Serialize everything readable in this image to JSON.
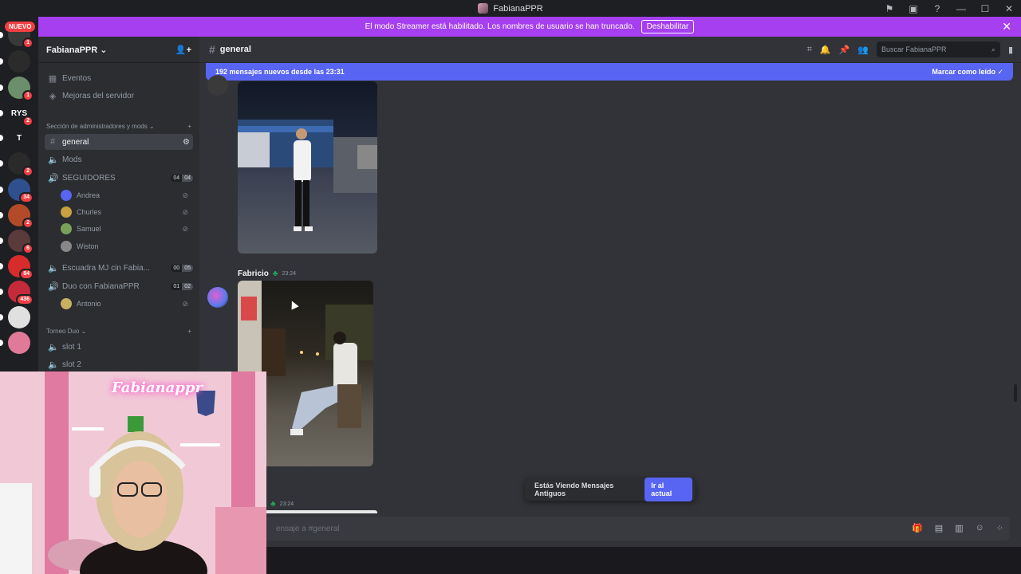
{
  "window": {
    "title": "FabianaPPR"
  },
  "rail": {
    "new_badge": "NUEVO",
    "guilds": [
      {
        "label": "",
        "badge": "1",
        "color": "#3a3a3a"
      },
      {
        "label": "",
        "badge": "",
        "color": "#2b2b2b"
      },
      {
        "label": "",
        "badge": "1",
        "color": "#6b8e6b"
      },
      {
        "label": "RYS",
        "badge": "2",
        "color": "#1e1f22"
      },
      {
        "label": "T",
        "badge": "",
        "color": "#1e1f22"
      },
      {
        "label": "",
        "badge": "2",
        "color": "#2a2a2a"
      },
      {
        "label": "",
        "badge": "34",
        "color": "#2f4f8f"
      },
      {
        "label": "",
        "badge": "2",
        "color": "#b34a2a"
      },
      {
        "label": "",
        "badge": "6",
        "color": "#5a3a3a"
      },
      {
        "label": "",
        "badge": "84",
        "color": "#d62c2c"
      },
      {
        "label": "",
        "badge": "436",
        "color": "#c42a3a"
      },
      {
        "label": "",
        "badge": "",
        "color": "#e0e0e0"
      },
      {
        "label": "",
        "badge": "",
        "color": "#e07a98"
      }
    ]
  },
  "banner": {
    "text": "El modo Streamer está habilitado. Los nombres de usuario se han truncado.",
    "button": "Deshabilitar"
  },
  "sidebar": {
    "server_name": "FabianaPPR",
    "events": "Eventos",
    "boosts": "Mejoras del servidor",
    "category_admin": "Sección de administradores y mods",
    "channels": {
      "general": "general",
      "mods": "Mods",
      "seguidores": "SEGUIDORES",
      "seguidores_count": [
        "04",
        "04"
      ],
      "escuadra": "Escuadra MJ cin Fabia...",
      "escuadra_count": [
        "00",
        "05"
      ],
      "duo": "Duo con FabianaPPR",
      "duo_count": [
        "01",
        "02"
      ]
    },
    "voice_users": [
      "Andrea",
      "Churles",
      "Samuel",
      "Wiston"
    ],
    "duo_users": [
      "Antonio"
    ],
    "category_torneo": "Torneo Duo",
    "slots": [
      "slot 1",
      "slot 2"
    ]
  },
  "header": {
    "channel": "general",
    "search_placeholder": "Buscar FabianaPPR"
  },
  "new_messages": {
    "text": "192 mensajes nuevos desde las 23:31",
    "mark_read": "Marcar como leído"
  },
  "messages": [
    {
      "author": "Fabricio",
      "time": "23:24"
    },
    {
      "author": "o",
      "time": "23:24"
    }
  ],
  "old_messages": {
    "text": "Estás Viendo Mensajes Antiguos",
    "button": "Ir al actual"
  },
  "composer": {
    "placeholder": "ensaje a #general"
  },
  "webcam": {
    "sign": "Fabianappr"
  }
}
